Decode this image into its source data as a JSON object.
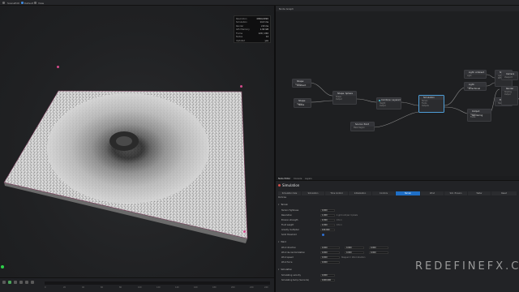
{
  "topbar": {
    "items": [
      "Scene",
      "Edit",
      "Default",
      "View"
    ],
    "right_title": "Node Graph"
  },
  "viewport": {
    "stats": [
      {
        "label": "Resolution",
        "value": "4096x4096"
      },
      {
        "label": "Simulation",
        "value": "14.3 ms"
      },
      {
        "label": "Render",
        "value": "2.8 ms"
      },
      {
        "label": "GPU Memory",
        "value": "1.92 GB"
      },
      {
        "label": "Frame",
        "value": "120 / 240"
      },
      {
        "label": "Nodes",
        "value": "14"
      },
      {
        "label": "Updated",
        "value": "yes"
      }
    ]
  },
  "timeline": {
    "ticks": [
      "0",
      "20",
      "40",
      "60",
      "80",
      "100",
      "120",
      "140",
      "160",
      "180",
      "200",
      "220",
      "240"
    ]
  },
  "graph": {
    "nodes": [
      {
        "title": "Shape: Gradient",
        "ports": [
          "Shape"
        ]
      },
      {
        "title": "Shape: Noise",
        "ports": [
          "Shape",
          "Output"
        ]
      },
      {
        "title": "Shape: Sphere",
        "ports": [
          "Shape",
          "Output"
        ]
      },
      {
        "title": "Combine: Layered",
        "ports": [
          "Height",
          "Output"
        ]
      },
      {
        "title": "Simulation",
        "ports": [
          "Terrain",
          "Fluids",
          "Outputs"
        ]
      },
      {
        "title": "Source: Point",
        "ports": [
          "Mask Region"
        ]
      },
      {
        "title": "Light: Ambient",
        "ports": [
          "Light"
        ]
      },
      {
        "title": "Light: Directional",
        "ports": [
          "Light"
        ]
      },
      {
        "title": "Shading",
        "ports": [
          "Lighting",
          "Diffuse"
        ]
      },
      {
        "title": "Erosion",
        "ports": [
          "Height"
        ]
      },
      {
        "title": "Output: Rendering",
        "ports": [
          "Terrain",
          "Fluids"
        ]
      },
      {
        "title": "Camera",
        "ports": [
          "Viewport"
        ]
      },
      {
        "title": "Render",
        "ports": [
          "Shading",
          "Output"
        ]
      }
    ]
  },
  "properties": {
    "tabs": [
      "Node Editor",
      "Console",
      "Layers"
    ],
    "title": "Simulation",
    "categories": [
      "Simulation Size",
      "Simulation",
      "Time Control",
      "Initialization",
      "Controls",
      "Terrain",
      "Wind",
      "Sim. Erosion",
      "Water",
      "Reset"
    ],
    "subtab": "Particles",
    "sections": {
      "terrain": "Terrain",
      "wind": "Wind",
      "simulation": "Simulation"
    },
    "terrain_rows": [
      {
        "label": "Terrain Tightness",
        "value": "0.000",
        "note": ""
      },
      {
        "label": "Resolution",
        "value": "1.000",
        "note": "1 grid unit per 4 pixels"
      },
      {
        "label": "Erosion strength",
        "value": "0.300",
        "note": "0 to 1"
      },
      {
        "label": "Fluid weight",
        "value": "0.300",
        "note": "0 to 1"
      },
      {
        "label": "Gravity multiplier",
        "value": "100.000",
        "note": ""
      },
      {
        "label": "Solid threshold",
        "value": "",
        "note": ""
      }
    ],
    "wind_rows": [
      {
        "label": "Wind direction",
        "values": [
          "0.000",
          "0.000",
          "0.000"
        ]
      },
      {
        "label": "Wind de-randomization",
        "values": [
          "0.000",
          "0.000",
          "0.000"
        ]
      },
      {
        "label": "Wind speed",
        "values": [
          "0.000"
        ],
        "note": "Stepped = Wind direction"
      },
      {
        "label": "Wind force",
        "values": [
          "0.000"
        ],
        "note": ""
      }
    ],
    "sim_rows": [
      {
        "label": "Simulating velocity",
        "value": "0.000"
      },
      {
        "label": "Simulating temp (Seconds)",
        "value": "1000.000"
      }
    ]
  },
  "watermark": "REDEFINEFX.COM",
  "colors": {
    "accent": "#1f6fc6",
    "selection": "#4e9ed8",
    "axis": "#2ed24a",
    "camera": "#d34a8a"
  }
}
